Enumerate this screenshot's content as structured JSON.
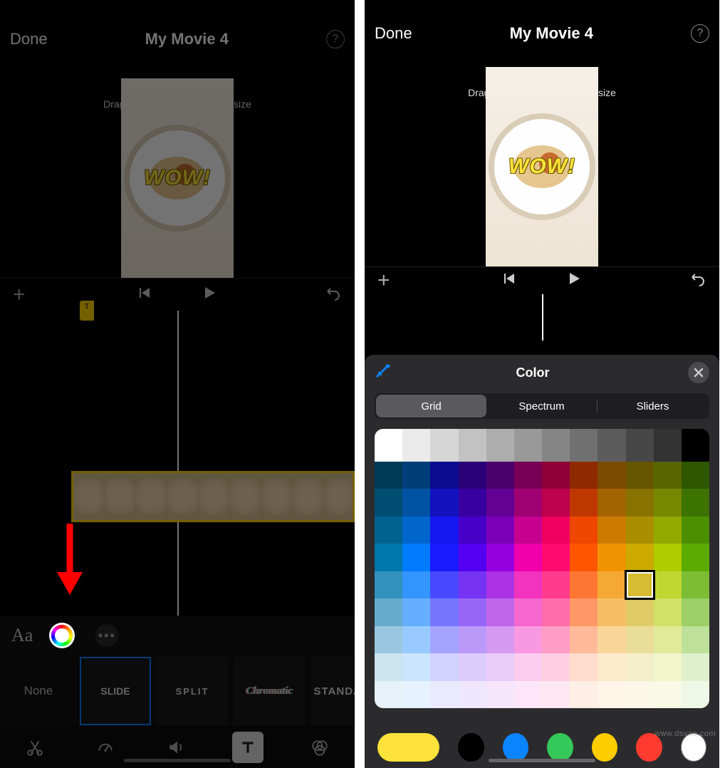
{
  "left": {
    "done": "Done",
    "title": "My Movie 4",
    "help": "?",
    "hint": "Drag title to move, pinch to resize",
    "overlay_text": "WOW!",
    "transport": {
      "add": "+"
    },
    "format": {
      "aa": "Aa",
      "more": "•••"
    },
    "styles": {
      "none": "None",
      "slide": "SLIDE",
      "split": "SPLIT",
      "chromatic": "Chromatic",
      "standard": "STANDARD"
    },
    "clip_marker": "T"
  },
  "right": {
    "done": "Done",
    "title": "My Movie 4",
    "help": "?",
    "hint": "Drag title to move, pinch to resize",
    "overlay_text": "WOW!",
    "panel_title": "Color",
    "tabs": {
      "grid": "Grid",
      "spectrum": "Spectrum",
      "sliders": "Sliders"
    },
    "grid": {
      "greys": [
        "#ffffff",
        "#ebebeb",
        "#d6d6d6",
        "#c2c2c2",
        "#adadad",
        "#999999",
        "#858585",
        "#707070",
        "#5c5c5c",
        "#474747",
        "#333333",
        "#000000"
      ],
      "rows": [
        [
          "#003a57",
          "#003e7a",
          "#0b0b8f",
          "#2a0077",
          "#4b006e",
          "#770055",
          "#8f0038",
          "#8f2a00",
          "#7a4a00",
          "#665500",
          "#586600",
          "#2e5700"
        ],
        [
          "#004d73",
          "#0052a3",
          "#1212bf",
          "#3800a0",
          "#640094",
          "#9f0072",
          "#bf004b",
          "#bf3800",
          "#a36300",
          "#887200",
          "#758800",
          "#3d7300"
        ],
        [
          "#00628f",
          "#0066cc",
          "#1616ef",
          "#4600c8",
          "#7d00b9",
          "#c7008f",
          "#ef005e",
          "#ef4600",
          "#cc7b00",
          "#aa8e00",
          "#92aa00",
          "#4c8f00"
        ],
        [
          "#0076ab",
          "#007aff",
          "#1a1aff",
          "#5400f0",
          "#9600de",
          "#ef00ab",
          "#ff0a70",
          "#ff5400",
          "#f09300",
          "#ccaa00",
          "#afcc00",
          "#5bab00"
        ],
        [
          "#3391bd",
          "#3395ff",
          "#4848ff",
          "#7633f3",
          "#ab33e5",
          "#f233bd",
          "#ff3b8d",
          "#ff7633",
          "#f3a933",
          "#d6bb33",
          "#c0d633",
          "#7cbd33"
        ],
        [
          "#66accf",
          "#66afff",
          "#7676ff",
          "#9866f6",
          "#c066eb",
          "#f666cf",
          "#ff6caa",
          "#ff9866",
          "#f6bf66",
          "#e0cc66",
          "#d1e066",
          "#9dcf66"
        ],
        [
          "#99c7e1",
          "#99caff",
          "#a4a4ff",
          "#ba99f9",
          "#d599f1",
          "#f999e1",
          "#ff9dc6",
          "#ffba99",
          "#f9d599",
          "#eadd99",
          "#e1ea99",
          "#bee199"
        ],
        [
          "#cce3f0",
          "#cce5ff",
          "#d2d2ff",
          "#dcccfc",
          "#eaccf8",
          "#fcccf0",
          "#ffcee3",
          "#ffdccc",
          "#fceacc",
          "#f5eecc",
          "#f0f5cc",
          "#dff0cc"
        ],
        [
          "#e6f1f8",
          "#e6f2ff",
          "#e9e9ff",
          "#eee6fe",
          "#f5e6fc",
          "#fee6f8",
          "#ffe7f1",
          "#ffeee6",
          "#fef5e6",
          "#faf7e6",
          "#f8fae6",
          "#eff8e6"
        ]
      ],
      "selected": {
        "row": 4,
        "col": 9,
        "color": "#ccaa00"
      }
    },
    "recent": [
      "#ffe23a",
      "#000000",
      "#0a84ff",
      "#34c759",
      "#ffcc00",
      "#ff3b30",
      "#ffffff"
    ]
  },
  "watermark": "www.dsvaq.com"
}
